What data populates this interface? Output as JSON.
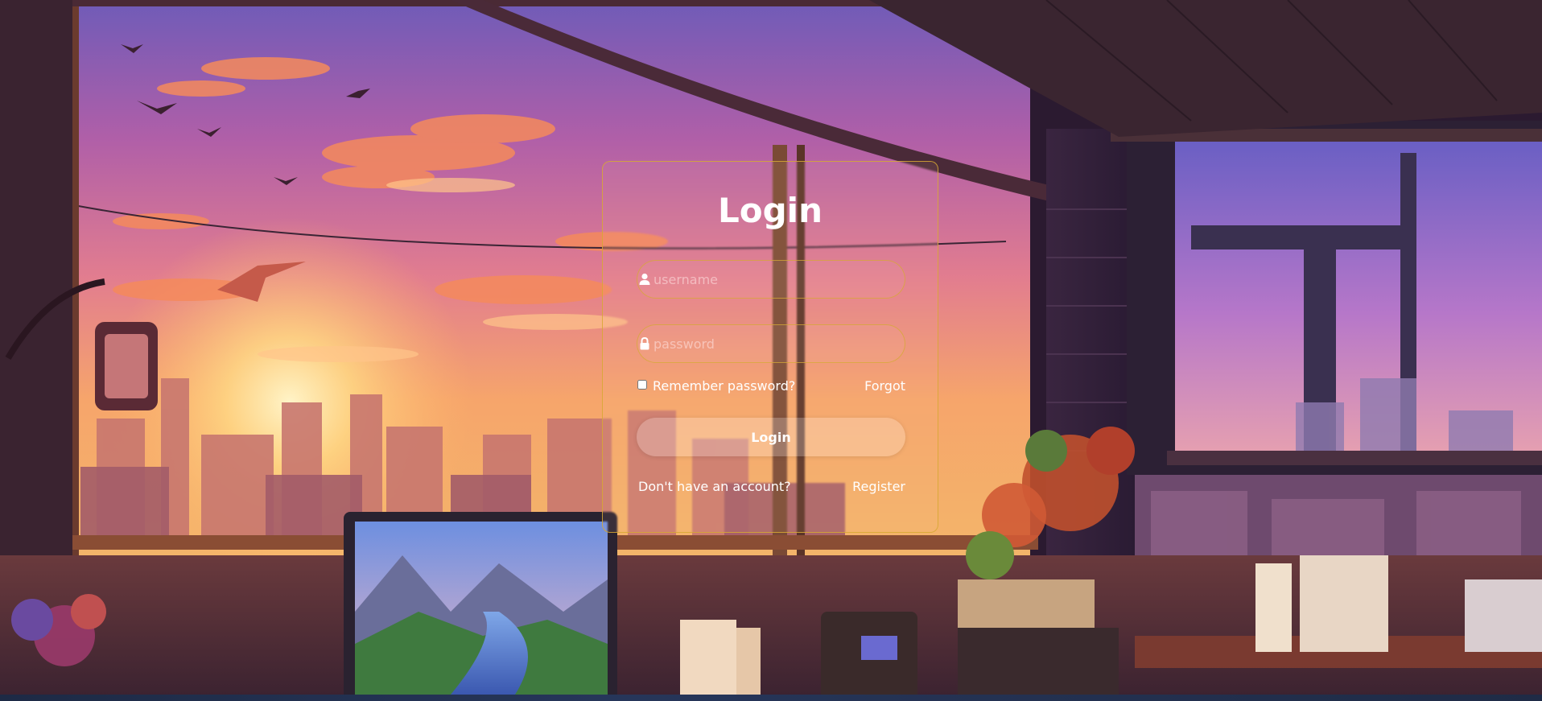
{
  "login": {
    "title": "Login",
    "username_placeholder": "username",
    "username_icon": "user-icon",
    "password_placeholder": "password",
    "password_icon": "lock-icon",
    "remember_label": "Remember password?",
    "remember_checked": false,
    "forgot_label": "Forgot",
    "submit_label": "Login",
    "no_account_text": "Don't have an account?",
    "register_label": "Register"
  },
  "colors": {
    "border_accent": "#d6a834",
    "text": "#ffffff"
  }
}
